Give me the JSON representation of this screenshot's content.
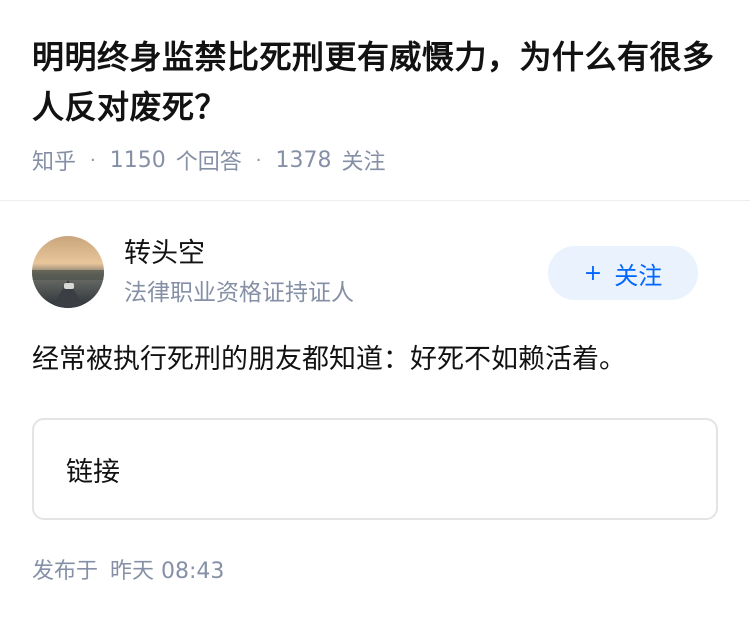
{
  "question": {
    "title": "明明终身监禁比死刑更有威慑力，为什么有很多人反对废死？",
    "source": "知乎",
    "answer_count": "1150",
    "answer_label": "个回答",
    "follower_count": "1378",
    "follower_label": "关注"
  },
  "author": {
    "name": "转头空",
    "badge": "法律职业资格证持证人",
    "follow_label": "关注",
    "follow_icon": "+"
  },
  "answer": {
    "text": "经常被执行死刑的朋友都知道：好死不如赖活着。",
    "link_label": "链接"
  },
  "footer": {
    "published_label": "发布于",
    "published_time": "昨天 08:43"
  },
  "colors": {
    "accent": "#0066ff",
    "follow_bg": "#e9f2fd",
    "meta_gray": "#8590a6"
  }
}
